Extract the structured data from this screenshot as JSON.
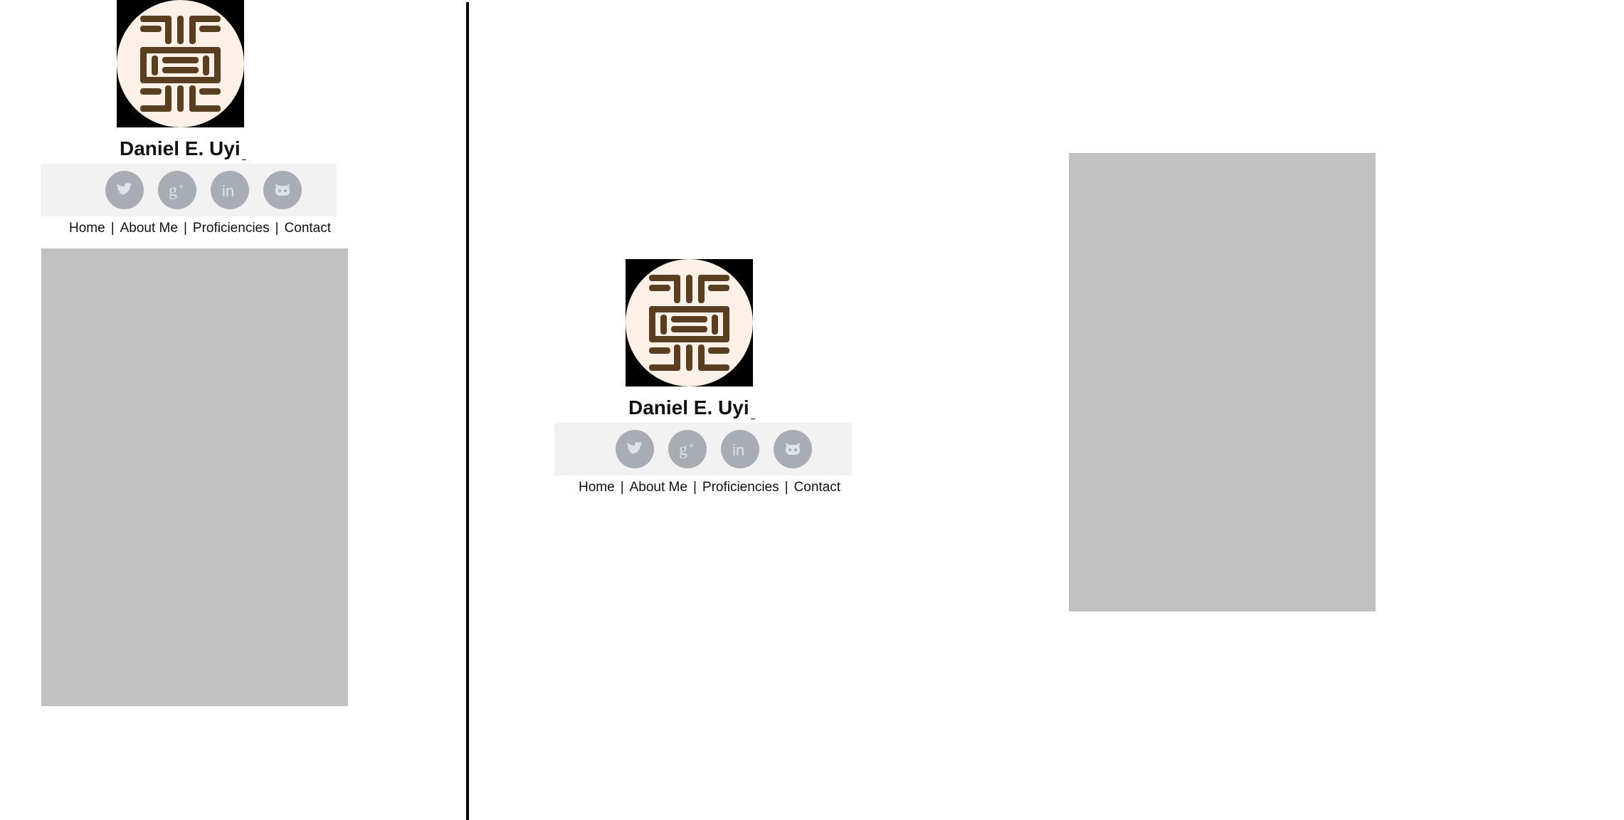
{
  "profile": {
    "name": "Daniel E. Uyi"
  },
  "social": {
    "twitter_icon": "twitter-icon",
    "googleplus_icon": "google-plus-icon",
    "linkedin_icon": "linkedin-icon",
    "github_icon": "github-icon"
  },
  "nav": {
    "home": "Home",
    "about": "About Me",
    "proficiencies": "Proficiencies",
    "contact": "Contact",
    "separator": "|"
  },
  "colors": {
    "logo_bg": "#000000",
    "logo_circle": "#fdf0e6",
    "logo_glyph": "#5a3e22",
    "social_bar": "#f2f2f2",
    "social_icon": "#a8adb5",
    "placeholder": "#c1c1c1",
    "divider": "#000000"
  }
}
